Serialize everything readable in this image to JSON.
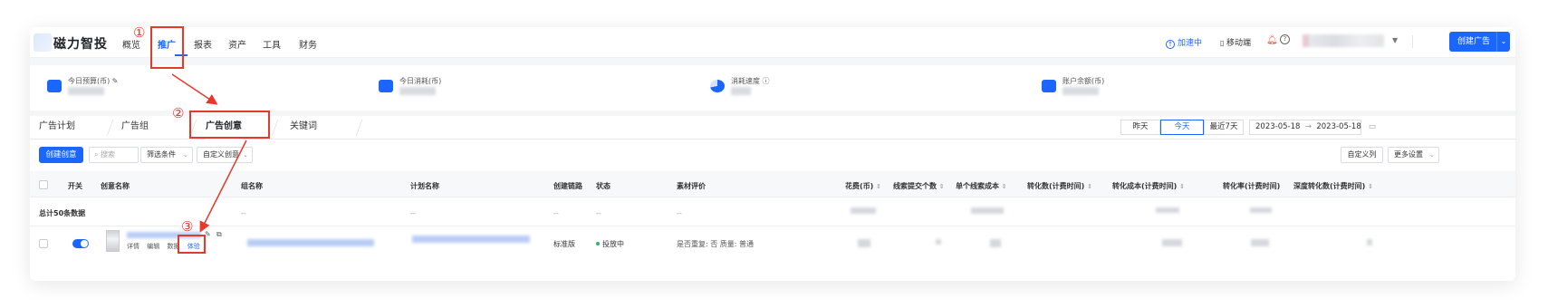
{
  "brand": {
    "name": "磁力智投"
  },
  "nav": {
    "items": [
      {
        "label": "概览",
        "active": false
      },
      {
        "label": "推广",
        "active": true
      },
      {
        "label": "报表",
        "active": false
      },
      {
        "label": "资产",
        "active": false
      },
      {
        "label": "工具",
        "active": false
      },
      {
        "label": "财务",
        "active": false
      }
    ],
    "accelerate": "加速中",
    "mobile": "移动端",
    "create_ad": "创建广告"
  },
  "stats": {
    "budget_label": "今日预算(币)",
    "spend_label": "今日消耗(币)",
    "speed_label": "消耗速度",
    "balance_label": "账户余额(币)"
  },
  "tabs": [
    {
      "label": "广告计划",
      "active": false
    },
    {
      "label": "广告组",
      "active": false
    },
    {
      "label": "广告创意",
      "active": true
    },
    {
      "label": "关键词",
      "active": false
    }
  ],
  "date_filter": {
    "options": [
      "昨天",
      "今天",
      "最近7天"
    ],
    "selected": "今天",
    "start": "2023-05-18",
    "end": "2023-05-18",
    "separator": "→"
  },
  "toolbar": {
    "create_creative": "创建创意",
    "search_placeholder": "搜索",
    "filter": "筛选条件",
    "custom_creative": "自定义创意",
    "custom_columns": "自定义列",
    "more_settings": "更多设置"
  },
  "table": {
    "headers": {
      "switch": "开关",
      "creative_name": "创意名称",
      "group_name": "组名称",
      "plan_name": "计划名称",
      "link": "创建链路",
      "status": "状态",
      "material_eval": "素材评价",
      "cost": "花费(币)",
      "leads": "线索提交个数",
      "lead_cost": "单个线索成本",
      "conversions": "转化数(计费时间)",
      "conv_cost": "转化成本(计费时间)",
      "conv_rate": "转化率(计费时间)",
      "deep_conv": "深度转化数(计费时间)"
    },
    "total_label": "总计50条数据",
    "placeholder": "--",
    "row": {
      "actions": [
        "详情",
        "编辑",
        "数据",
        "体验"
      ],
      "link": "标准版",
      "status": "投放中",
      "material_eval": "是否重复: 否   质量: 普通"
    }
  },
  "annotations": {
    "step1": "①",
    "step2": "②",
    "step3": "③"
  },
  "colors": {
    "accent": "#1a66ff",
    "annotation": "#e6392c",
    "status_ok": "#2bb673"
  }
}
